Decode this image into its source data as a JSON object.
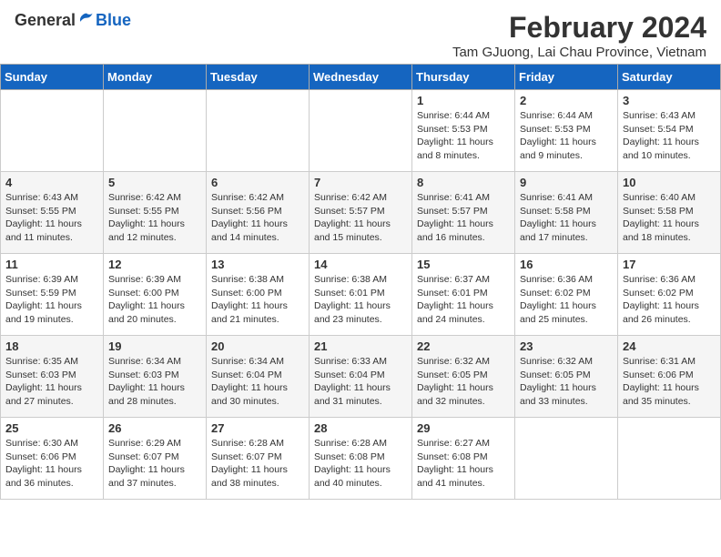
{
  "header": {
    "logo_general": "General",
    "logo_blue": "Blue",
    "month_year": "February 2024",
    "location": "Tam GJuong, Lai Chau Province, Vietnam"
  },
  "days_of_week": [
    "Sunday",
    "Monday",
    "Tuesday",
    "Wednesday",
    "Thursday",
    "Friday",
    "Saturday"
  ],
  "weeks": [
    [
      {
        "day": "",
        "info": ""
      },
      {
        "day": "",
        "info": ""
      },
      {
        "day": "",
        "info": ""
      },
      {
        "day": "",
        "info": ""
      },
      {
        "day": "1",
        "info": "Sunrise: 6:44 AM\nSunset: 5:53 PM\nDaylight: 11 hours\nand 8 minutes."
      },
      {
        "day": "2",
        "info": "Sunrise: 6:44 AM\nSunset: 5:53 PM\nDaylight: 11 hours\nand 9 minutes."
      },
      {
        "day": "3",
        "info": "Sunrise: 6:43 AM\nSunset: 5:54 PM\nDaylight: 11 hours\nand 10 minutes."
      }
    ],
    [
      {
        "day": "4",
        "info": "Sunrise: 6:43 AM\nSunset: 5:55 PM\nDaylight: 11 hours\nand 11 minutes."
      },
      {
        "day": "5",
        "info": "Sunrise: 6:42 AM\nSunset: 5:55 PM\nDaylight: 11 hours\nand 12 minutes."
      },
      {
        "day": "6",
        "info": "Sunrise: 6:42 AM\nSunset: 5:56 PM\nDaylight: 11 hours\nand 14 minutes."
      },
      {
        "day": "7",
        "info": "Sunrise: 6:42 AM\nSunset: 5:57 PM\nDaylight: 11 hours\nand 15 minutes."
      },
      {
        "day": "8",
        "info": "Sunrise: 6:41 AM\nSunset: 5:57 PM\nDaylight: 11 hours\nand 16 minutes."
      },
      {
        "day": "9",
        "info": "Sunrise: 6:41 AM\nSunset: 5:58 PM\nDaylight: 11 hours\nand 17 minutes."
      },
      {
        "day": "10",
        "info": "Sunrise: 6:40 AM\nSunset: 5:58 PM\nDaylight: 11 hours\nand 18 minutes."
      }
    ],
    [
      {
        "day": "11",
        "info": "Sunrise: 6:39 AM\nSunset: 5:59 PM\nDaylight: 11 hours\nand 19 minutes."
      },
      {
        "day": "12",
        "info": "Sunrise: 6:39 AM\nSunset: 6:00 PM\nDaylight: 11 hours\nand 20 minutes."
      },
      {
        "day": "13",
        "info": "Sunrise: 6:38 AM\nSunset: 6:00 PM\nDaylight: 11 hours\nand 21 minutes."
      },
      {
        "day": "14",
        "info": "Sunrise: 6:38 AM\nSunset: 6:01 PM\nDaylight: 11 hours\nand 23 minutes."
      },
      {
        "day": "15",
        "info": "Sunrise: 6:37 AM\nSunset: 6:01 PM\nDaylight: 11 hours\nand 24 minutes."
      },
      {
        "day": "16",
        "info": "Sunrise: 6:36 AM\nSunset: 6:02 PM\nDaylight: 11 hours\nand 25 minutes."
      },
      {
        "day": "17",
        "info": "Sunrise: 6:36 AM\nSunset: 6:02 PM\nDaylight: 11 hours\nand 26 minutes."
      }
    ],
    [
      {
        "day": "18",
        "info": "Sunrise: 6:35 AM\nSunset: 6:03 PM\nDaylight: 11 hours\nand 27 minutes."
      },
      {
        "day": "19",
        "info": "Sunrise: 6:34 AM\nSunset: 6:03 PM\nDaylight: 11 hours\nand 28 minutes."
      },
      {
        "day": "20",
        "info": "Sunrise: 6:34 AM\nSunset: 6:04 PM\nDaylight: 11 hours\nand 30 minutes."
      },
      {
        "day": "21",
        "info": "Sunrise: 6:33 AM\nSunset: 6:04 PM\nDaylight: 11 hours\nand 31 minutes."
      },
      {
        "day": "22",
        "info": "Sunrise: 6:32 AM\nSunset: 6:05 PM\nDaylight: 11 hours\nand 32 minutes."
      },
      {
        "day": "23",
        "info": "Sunrise: 6:32 AM\nSunset: 6:05 PM\nDaylight: 11 hours\nand 33 minutes."
      },
      {
        "day": "24",
        "info": "Sunrise: 6:31 AM\nSunset: 6:06 PM\nDaylight: 11 hours\nand 35 minutes."
      }
    ],
    [
      {
        "day": "25",
        "info": "Sunrise: 6:30 AM\nSunset: 6:06 PM\nDaylight: 11 hours\nand 36 minutes."
      },
      {
        "day": "26",
        "info": "Sunrise: 6:29 AM\nSunset: 6:07 PM\nDaylight: 11 hours\nand 37 minutes."
      },
      {
        "day": "27",
        "info": "Sunrise: 6:28 AM\nSunset: 6:07 PM\nDaylight: 11 hours\nand 38 minutes."
      },
      {
        "day": "28",
        "info": "Sunrise: 6:28 AM\nSunset: 6:08 PM\nDaylight: 11 hours\nand 40 minutes."
      },
      {
        "day": "29",
        "info": "Sunrise: 6:27 AM\nSunset: 6:08 PM\nDaylight: 11 hours\nand 41 minutes."
      },
      {
        "day": "",
        "info": ""
      },
      {
        "day": "",
        "info": ""
      }
    ]
  ]
}
